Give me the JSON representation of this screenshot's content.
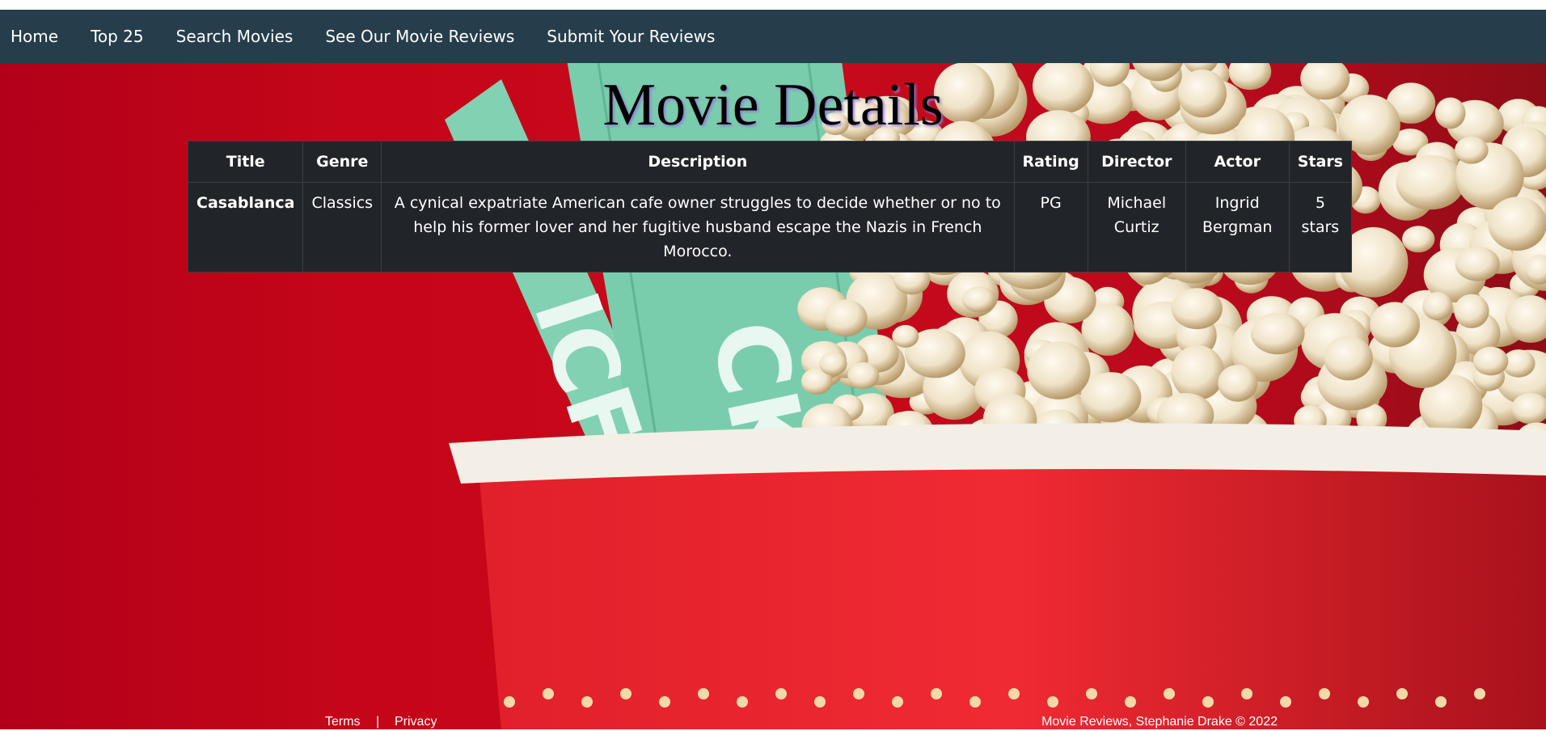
{
  "navbar": {
    "links": [
      {
        "label": "Home"
      },
      {
        "label": "Top 25"
      },
      {
        "label": "Search Movies"
      },
      {
        "label": "See Our Movie Reviews"
      },
      {
        "label": "Submit Your Reviews"
      }
    ]
  },
  "page_title": "Movie Details",
  "table": {
    "headers": [
      "Title",
      "Genre",
      "Description",
      "Rating",
      "Director",
      "Actor",
      "Stars"
    ],
    "rows": [
      {
        "title": "Casablanca",
        "genre": "Classics",
        "description": "A cynical expatriate American cafe owner struggles to decide whether or no to help his former lover and her fugitive husband escape the Nazis in French Morocco.",
        "rating": "PG",
        "director": "Michael Curtiz",
        "actor": "Ingrid Bergman",
        "stars": "5 stars"
      }
    ]
  },
  "footer": {
    "terms": "Terms",
    "separator": "|",
    "privacy": "Privacy",
    "copyright": "Movie Reviews, Stephanie Drake © 2022"
  },
  "colors": {
    "navbar": "#263e4c",
    "background_red": "#c40618",
    "table_bg": "#212529",
    "ticket_green": "#7ccfae"
  }
}
